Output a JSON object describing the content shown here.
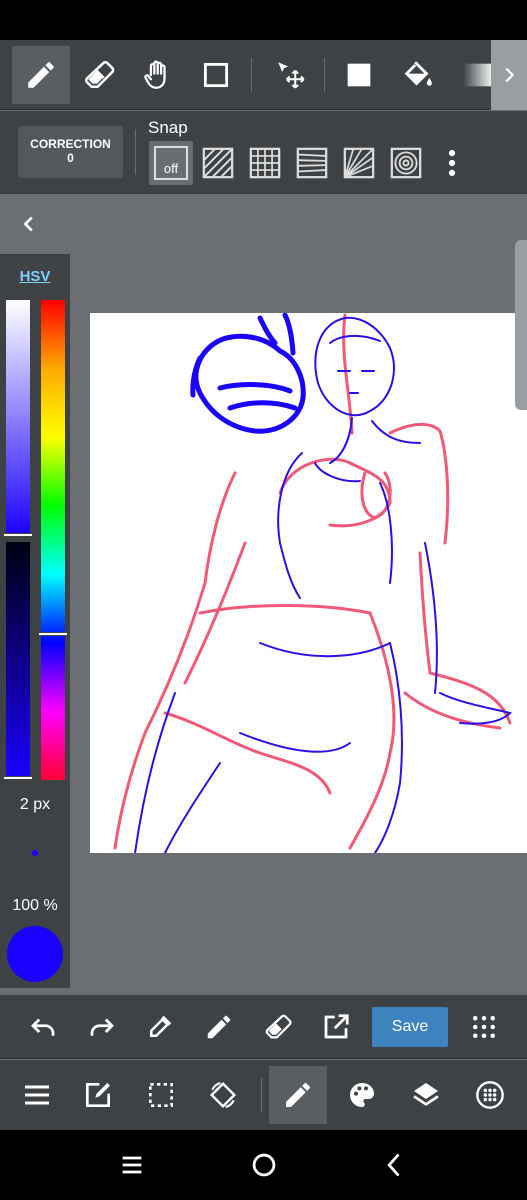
{
  "toolbar": {
    "tools": [
      "pen-icon",
      "eraser-icon",
      "hand-icon",
      "rectangle-select-icon",
      "move-transform-icon",
      "fill-rect-icon",
      "bucket-icon",
      "gradient-icon"
    ],
    "active_tool": "pen-icon"
  },
  "options": {
    "correction_label": "CORRECTION",
    "correction_value": "0",
    "snap_label": "Snap",
    "snap_off": "off"
  },
  "color_panel": {
    "mode": "HSV",
    "brush_size": "2 px",
    "opacity": "100 %",
    "current_color": "#1a00ff"
  },
  "actions": {
    "save_label": "Save"
  },
  "colors": {
    "toolbar_bg": "#3e4245",
    "canvas_bg": "#ffffff",
    "accent": "#3d83c0",
    "sketch_blue": "#1a00ff",
    "sketch_red": "#f05a78"
  }
}
